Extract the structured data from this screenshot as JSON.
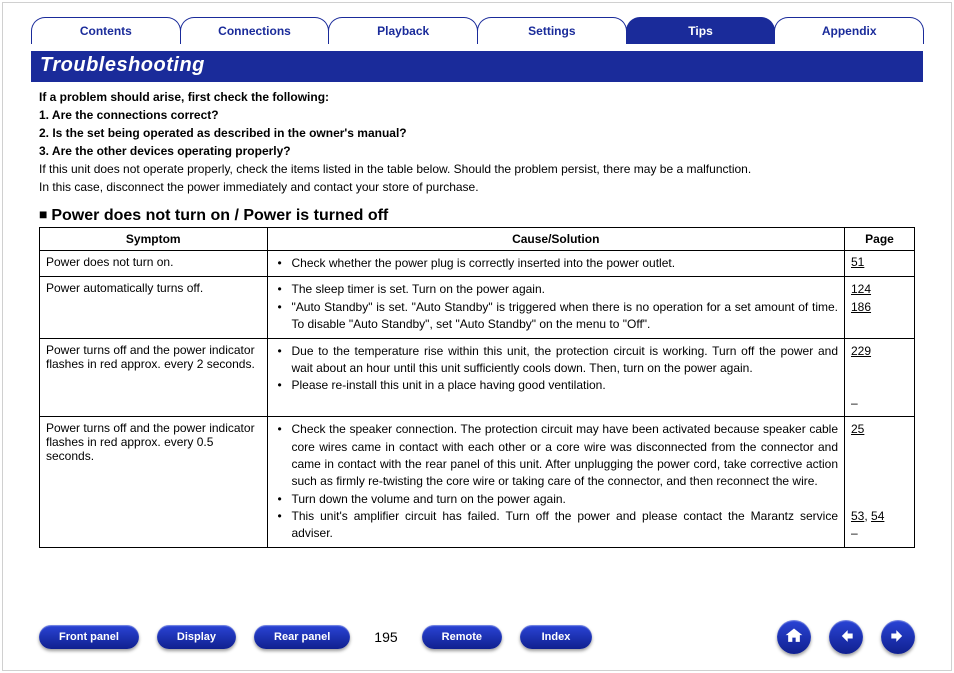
{
  "tabs": {
    "contents": "Contents",
    "connections": "Connections",
    "playback": "Playback",
    "settings": "Settings",
    "tips": "Tips",
    "appendix": "Appendix"
  },
  "title": "Troubleshooting",
  "intro": {
    "l0": "If a problem should arise, first check the following:",
    "l1": "1. Are the connections correct?",
    "l2": "2. Is the set being operated as described in the owner's manual?",
    "l3": "3. Are the other devices operating properly?",
    "l4": "If this unit does not operate properly, check the items listed in the table below. Should the problem persist, there may be a malfunction.",
    "l5": "In this case, disconnect the power immediately and contact your store of purchase."
  },
  "section_heading": "Power does not turn on / Power is turned off",
  "table": {
    "h_symptom": "Symptom",
    "h_cause": "Cause/Solution",
    "h_page": "Page",
    "rows": [
      {
        "symptom": "Power does not turn on.",
        "cause0": "Check whether the power plug is correctly inserted into the power outlet.",
        "page_html": "<a>51</a>"
      },
      {
        "symptom": "Power automatically turns off.",
        "cause0": "The sleep timer is set. Turn on the power again.",
        "cause1": "\"Auto Standby\" is set. \"Auto Standby\" is triggered when there is no operation for a set amount of time. To disable \"Auto Standby\", set \"Auto Standby\" on the menu to \"Off\".",
        "page_html": "<div><a>124</a></div><div><a>186</a></div>"
      },
      {
        "symptom": "Power turns off and the power indicator flashes in red approx. every 2 seconds.",
        "cause0": "Due to the temperature rise within this unit, the protection circuit is working. Turn off the power and wait about an hour until this unit sufficiently cools down. Then, turn on the power again.",
        "cause1": "Please re-install this unit in a place having good ventilation.",
        "page_html": "<div><a>229</a></div><div>&nbsp;</div><div>&nbsp;</div><div>–</div>"
      },
      {
        "symptom": "Power turns off and the power indicator flashes in red approx. every 0.5 seconds.",
        "cause0": "Check the speaker connection. The protection circuit may have been activated because speaker cable core wires came in contact with each other or a core wire was disconnected from the connector and came in contact with the rear panel of this unit. After unplugging the power cord, take corrective action such as firmly re-twisting the core wire or taking care of the connector, and then reconnect the wire.",
        "cause1": "Turn down the volume and turn on the power again.",
        "cause2": "This unit's amplifier circuit has failed. Turn off the power and please contact the Marantz service adviser.",
        "page_html": "<div><a>25</a></div><div>&nbsp;</div><div>&nbsp;</div><div>&nbsp;</div><div>&nbsp;</div><div><a>53</a>, <a>54</a></div><div>–</div>"
      }
    ]
  },
  "bottom": {
    "front_panel": "Front panel",
    "display": "Display",
    "rear_panel": "Rear panel",
    "page_num": "195",
    "remote": "Remote",
    "index": "Index"
  }
}
